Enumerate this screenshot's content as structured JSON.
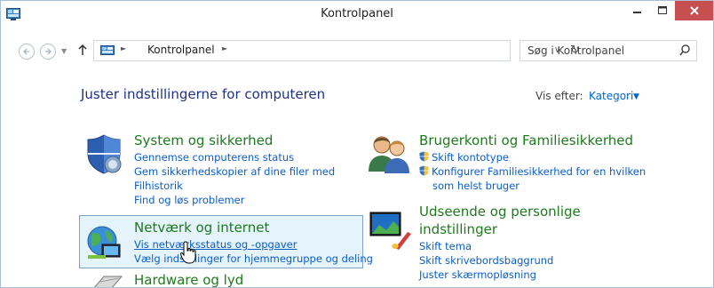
{
  "window": {
    "title": "Kontrolpanel",
    "controls": {
      "minimize": "–",
      "maximize": "□",
      "close": "✕"
    }
  },
  "addressbar": {
    "breadcrumb": "Kontrolpanel",
    "search_placeholder": "Søg i Kontrolpanel"
  },
  "content": {
    "title": "Juster indstillingerne for computeren",
    "view_by_label": "Vis efter:",
    "view_by_value": "Kategori"
  },
  "categories": [
    {
      "heading": "System og sikkerhed",
      "links": [
        "Gennemse computerens status",
        "Gem sikkerhedskopier af dine filer med",
        "Filhistorik",
        "Find og løs problemer"
      ]
    },
    {
      "heading": "Netværk og internet",
      "links": [
        "Vis netværksstatus og -opgaver",
        "Vælg indstillinger for hjemmegruppe og deling"
      ]
    },
    {
      "heading": "Hardware og lyd",
      "links": []
    },
    {
      "heading": "Brugerkonti og Familiesikkerhed",
      "links": [
        "Skift kontotype",
        "Konfigurer Familiesikkerhed for en hvilken",
        "som helst bruger"
      ]
    },
    {
      "heading_line1": "Udseende og personlige",
      "heading_line2": "indstillinger",
      "links": [
        "Skift tema",
        "Skift skrivebordsbaggrund",
        "Juster skærmopløsning"
      ]
    }
  ],
  "icons": {
    "app": "control-panel-icon",
    "back": "back-arrow-icon",
    "forward": "forward-arrow-icon",
    "up": "up-arrow-icon",
    "refresh": "refresh-icon",
    "search": "search-icon",
    "uac": "uac-shield-icon"
  }
}
